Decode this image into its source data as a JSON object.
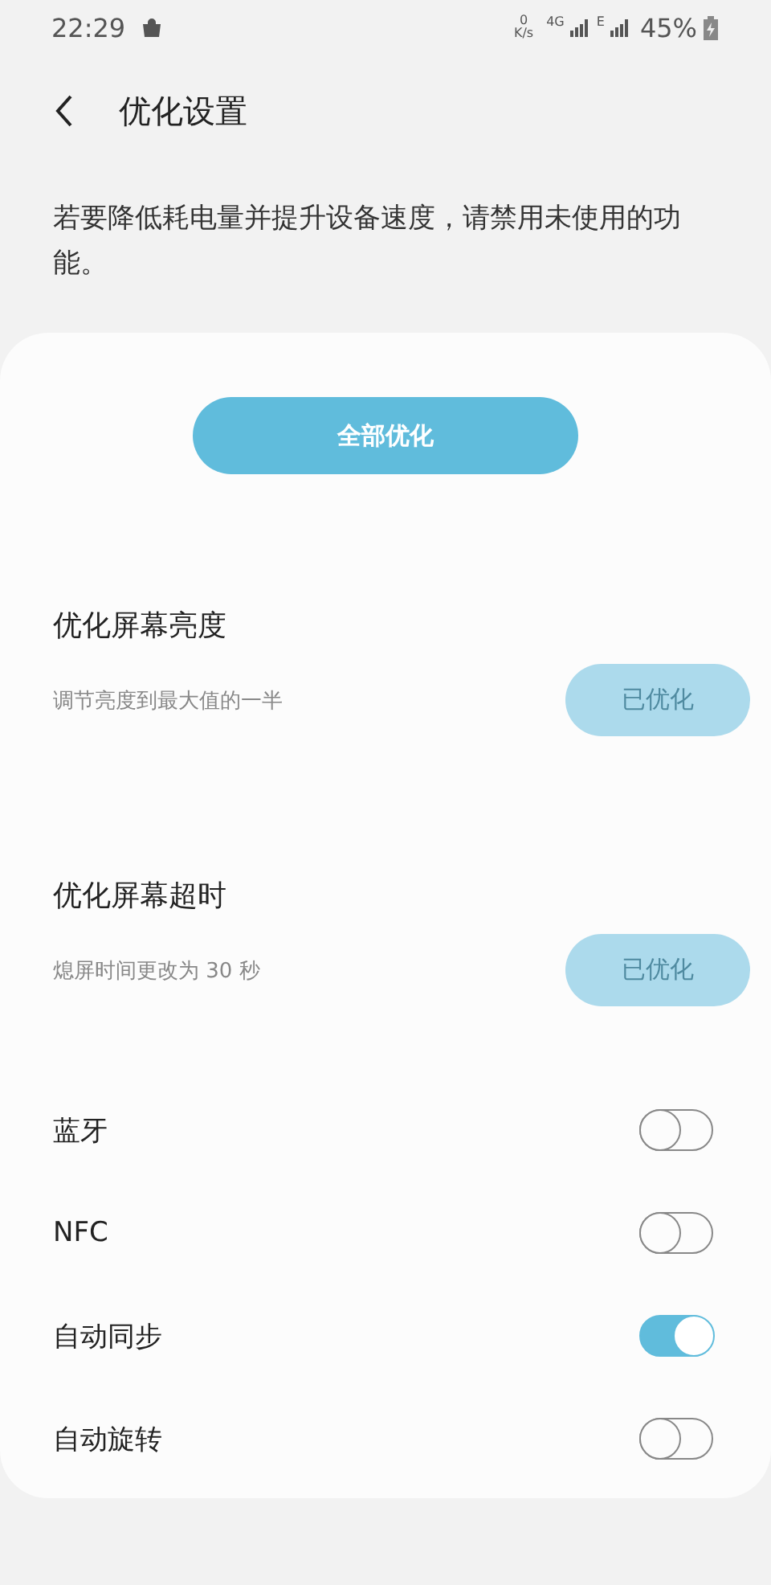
{
  "status_bar": {
    "time": "22:29",
    "speed_value": "0",
    "speed_unit": "K/s",
    "network_1": "4G",
    "network_2": "E",
    "battery": "45%"
  },
  "header": {
    "title": "优化设置"
  },
  "description": "若要降低耗电量并提升设备速度，请禁用未使用的功能。",
  "optimize_all_button": "全部优化",
  "optimizations": [
    {
      "title": "优化屏幕亮度",
      "subtitle": "调节亮度到最大值的一半",
      "button": "已优化",
      "disabled": true
    },
    {
      "title": "优化屏幕超时",
      "subtitle": "熄屏时间更改为 30 秒",
      "button": "已优化",
      "disabled": true
    }
  ],
  "toggles": [
    {
      "label": "蓝牙",
      "on": false
    },
    {
      "label": "NFC",
      "on": false
    },
    {
      "label": "自动同步",
      "on": true
    },
    {
      "label": "自动旋转",
      "on": false
    }
  ]
}
